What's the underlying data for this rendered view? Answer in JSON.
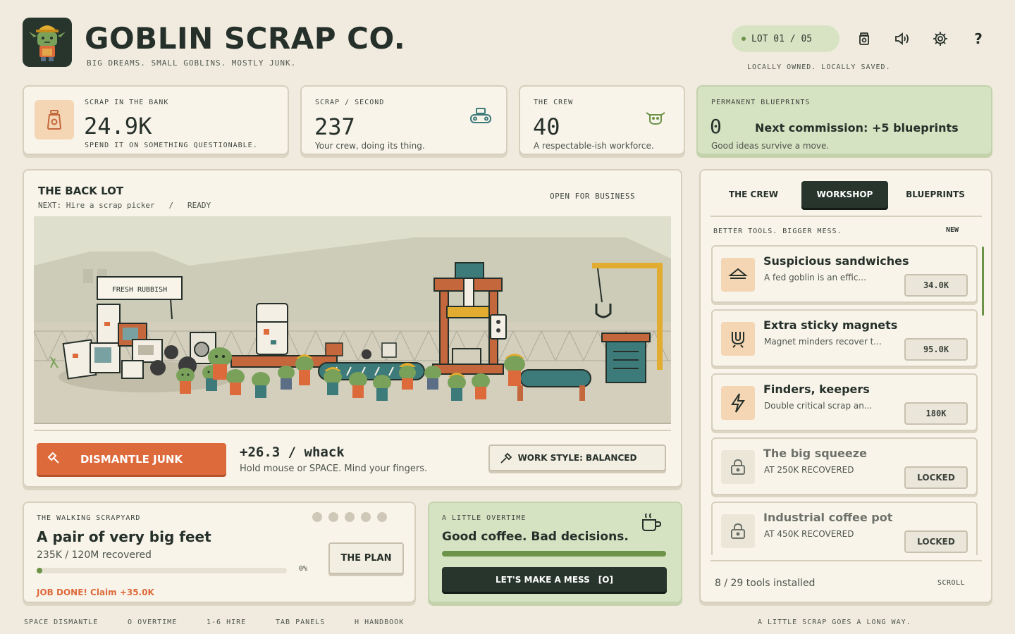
{
  "header": {
    "title": "GOBLIN SCRAP CO.",
    "tagline": "BIG DREAMS. SMALL GOBLINS. MOSTLY JUNK.",
    "lot": "LOT 01 / 05",
    "local_note": "LOCALLY OWNED. LOCALLY SAVED.",
    "icons": [
      "jar-icon",
      "sound-icon",
      "gear-icon",
      "help-icon"
    ],
    "help_label": "?"
  },
  "stats": {
    "bank": {
      "label": "SCRAP IN THE BANK",
      "value": "24.9K",
      "sub": "SPEND IT ON SOMETHING QUESTIONABLE."
    },
    "per_second": {
      "label": "SCRAP / SECOND",
      "value": "237",
      "sub": "Your crew, doing its thing."
    },
    "crew": {
      "label": "THE CREW",
      "value": "40",
      "sub": "A respectable-ish workforce."
    },
    "blueprints": {
      "label": "PERMANENT BLUEPRINTS",
      "value": "0",
      "next": "Next commission: +5 blueprints",
      "sub": "Good ideas survive a move."
    }
  },
  "backlot": {
    "title": "THE BACK LOT",
    "next": "NEXT: Hire a scrap picker",
    "sep": "/",
    "state": "READY",
    "status": "OPEN FOR BUSINESS",
    "sign": "FRESH RUBBISH",
    "dismantle_label": "DISMANTLE JUNK",
    "per_whack": "+26.3 / whack",
    "hint": "Hold mouse or SPACE. Mind your fingers.",
    "work_style": "WORK STYLE: BALANCED"
  },
  "scrapyard": {
    "label": "THE WALKING SCRAPYARD",
    "title": "A pair of very big feet",
    "progress_text": "235K / 120M recovered",
    "percent_label": "0%",
    "progress": 0.002,
    "plan_label": "THE PLAN",
    "claim": "JOB DONE! Claim +35.0K",
    "dots": 5
  },
  "overtime": {
    "label": "A LITTLE OVERTIME",
    "title": "Good coffee. Bad decisions.",
    "progress": 1.0,
    "button": "LET'S MAKE A MESS",
    "button_key": "[O]"
  },
  "panel": {
    "tabs": [
      "THE CREW",
      "WORKSHOP",
      "BLUEPRINTS"
    ],
    "active_tab": 1,
    "section": "BETTER TOOLS. BIGGER MESS.",
    "new_label": "NEW",
    "tools": [
      {
        "name": "Suspicious sandwiches",
        "desc": "A fed goblin is an effic...",
        "price": "34.0K",
        "icon": "sandwich-icon",
        "locked": false
      },
      {
        "name": "Extra sticky magnets",
        "desc": "Magnet minders recover t...",
        "price": "95.0K",
        "icon": "magnet-icon",
        "locked": false
      },
      {
        "name": "Finders, keepers",
        "desc": "Double critical scrap an...",
        "price": "180K",
        "icon": "lightning-icon",
        "locked": false
      },
      {
        "name": "The big squeeze",
        "desc": "AT 250K RECOVERED",
        "price": "LOCKED",
        "icon": "lock-icon",
        "locked": true
      },
      {
        "name": "Industrial coffee pot",
        "desc": "AT 450K RECOVERED",
        "price": "LOCKED",
        "icon": "lock-icon",
        "locked": true
      }
    ],
    "installed": "8 / 29 tools installed",
    "scroll": "SCROLL"
  },
  "footer": {
    "keys": [
      {
        "key": "SPACE",
        "action": "DISMANTLE"
      },
      {
        "key": "O",
        "action": "OVERTIME"
      },
      {
        "key": "1-6",
        "action": "HIRE"
      },
      {
        "key": "TAB",
        "action": "PANELS"
      },
      {
        "key": "H",
        "action": "HANDBOOK"
      }
    ],
    "motto": "A LITTLE SCRAP GOES A LONG WAY."
  },
  "colors": {
    "accent_orange": "#dd6a3b",
    "dark_green": "#27352d",
    "light_green": "#d6e3c2",
    "bar_green": "#6c9348",
    "background": "#f1ebdf"
  }
}
